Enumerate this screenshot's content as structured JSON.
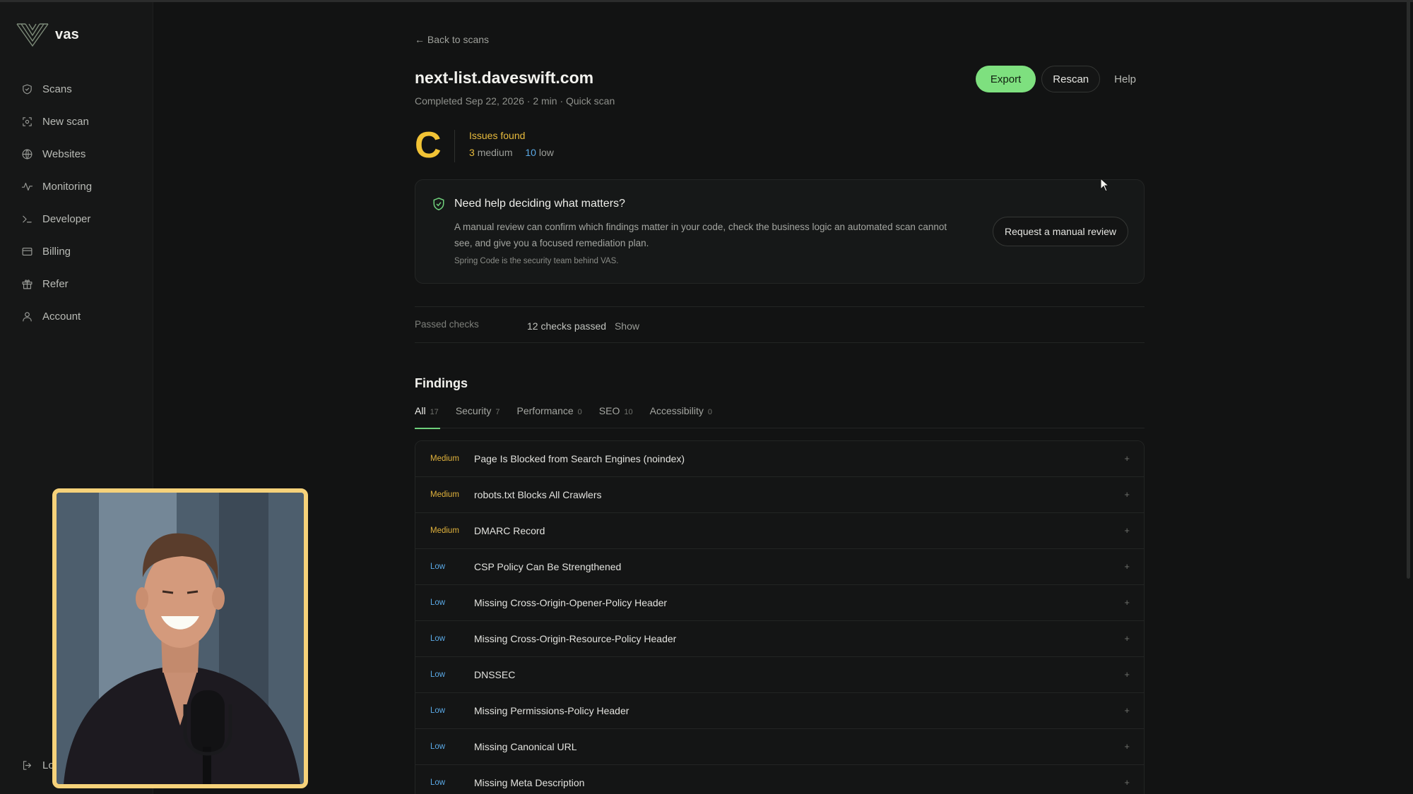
{
  "app": {
    "name": "vas"
  },
  "sidebar": {
    "items": [
      {
        "label": "Scans",
        "icon": "shield-icon"
      },
      {
        "label": "New scan",
        "icon": "scan-icon"
      },
      {
        "label": "Websites",
        "icon": "globe-icon"
      },
      {
        "label": "Monitoring",
        "icon": "activity-icon"
      },
      {
        "label": "Developer",
        "icon": "terminal-icon"
      },
      {
        "label": "Billing",
        "icon": "credit-card-icon"
      },
      {
        "label": "Refer",
        "icon": "gift-icon"
      },
      {
        "label": "Account",
        "icon": "user-icon"
      }
    ],
    "logout_label": "Lo"
  },
  "header": {
    "back_label": "← Back to scans",
    "title": "next-list.daveswift.com",
    "subtitle": "Completed Sep 22, 2026 · 2 min · Quick scan",
    "export_label": "Export",
    "rescan_label": "Rescan",
    "help_label": "Help"
  },
  "summary": {
    "grade": "C",
    "issues_title": "Issues found",
    "medium_count": "3",
    "medium_label": "medium",
    "low_count": "10",
    "low_label": "low"
  },
  "review": {
    "title": "Need help deciding what matters?",
    "body": "A manual review can confirm which findings matter in your code, check the business logic an automated scan cannot see, and give you a focused remediation plan.",
    "footer": "Spring Code is the security team behind VAS.",
    "button_label": "Request a manual review"
  },
  "passed": {
    "label": "Passed checks",
    "count_text": "12 checks passed",
    "show_label": "Show"
  },
  "findings": {
    "title": "Findings",
    "tabs": [
      {
        "label": "All",
        "count": "17"
      },
      {
        "label": "Security",
        "count": "7"
      },
      {
        "label": "Performance",
        "count": "0"
      },
      {
        "label": "SEO",
        "count": "10"
      },
      {
        "label": "Accessibility",
        "count": "0"
      }
    ],
    "rows": [
      {
        "severity": "Medium",
        "title": "Page Is Blocked from Search Engines (noindex)"
      },
      {
        "severity": "Medium",
        "title": "robots.txt Blocks All Crawlers"
      },
      {
        "severity": "Medium",
        "title": "DMARC Record"
      },
      {
        "severity": "Low",
        "title": "CSP Policy Can Be Strengthened"
      },
      {
        "severity": "Low",
        "title": "Missing Cross-Origin-Opener-Policy Header"
      },
      {
        "severity": "Low",
        "title": "Missing Cross-Origin-Resource-Policy Header"
      },
      {
        "severity": "Low",
        "title": "DNSSEC"
      },
      {
        "severity": "Low",
        "title": "Missing Permissions-Policy Header"
      },
      {
        "severity": "Low",
        "title": "Missing Canonical URL"
      },
      {
        "severity": "Low",
        "title": "Missing Meta Description"
      }
    ],
    "expand_glyph": "+"
  },
  "colors": {
    "accent_green": "#7ee07f",
    "grade_yellow": "#f2c335",
    "medium": "#e0b23c",
    "low": "#5aa9e6",
    "cam_border": "#f6d27a"
  }
}
